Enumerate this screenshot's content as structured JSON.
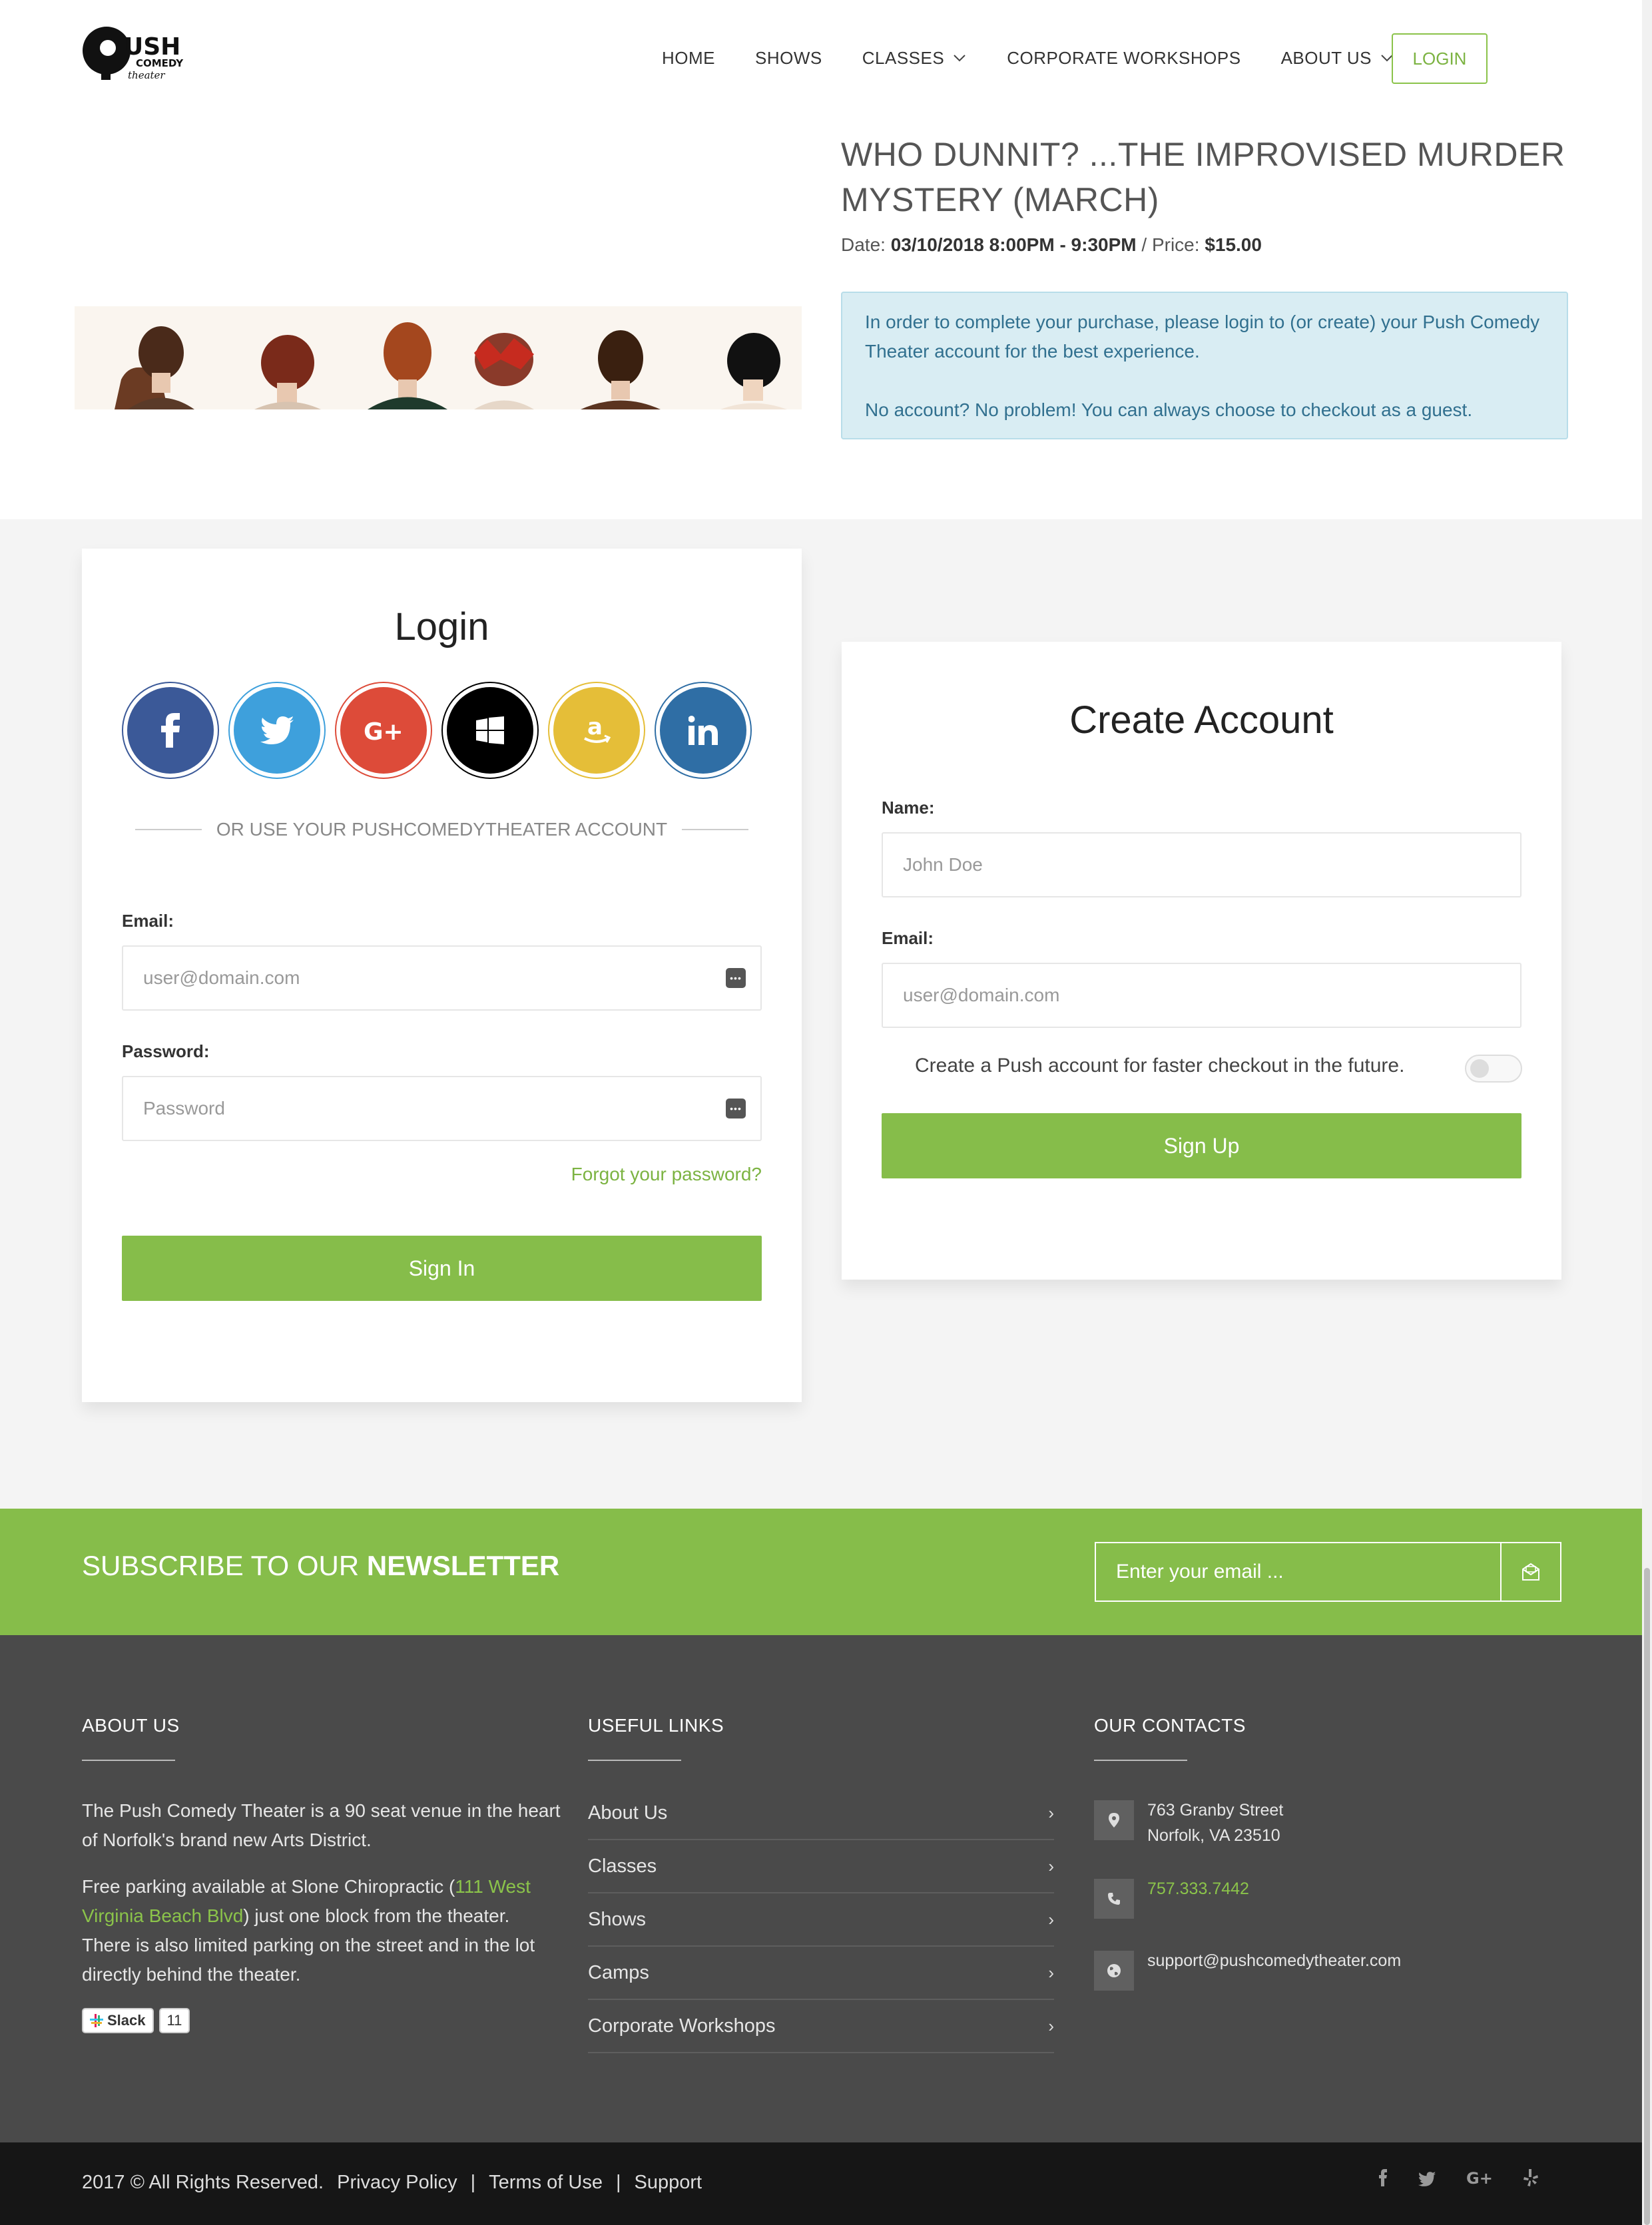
{
  "header": {
    "logo_text": "PUSH COMEDY theater",
    "nav": [
      {
        "label": "HOME",
        "dropdown": false
      },
      {
        "label": "SHOWS",
        "dropdown": false
      },
      {
        "label": "CLASSES",
        "dropdown": true
      },
      {
        "label": "CORPORATE WORKSHOPS",
        "dropdown": false
      },
      {
        "label": "ABOUT US",
        "dropdown": true
      }
    ],
    "login_label": "LOGIN"
  },
  "event": {
    "title": "WHO DUNNIT? ...THE IMPROVISED MURDER MYSTERY (MARCH)",
    "date_label": "Date:",
    "date_value": "03/10/2018 8:00PM - 9:30PM",
    "price_label": "/ Price:",
    "price_value": "$15.00",
    "info_p1": "In order to complete your purchase, please login to (or create) your Push Comedy Theater account for the best experience.",
    "info_p2": "No account? No problem! You can always choose to checkout as a guest."
  },
  "login": {
    "title": "Login",
    "social": [
      "facebook",
      "twitter",
      "google-plus",
      "windows",
      "amazon",
      "linkedin"
    ],
    "divider_text": "OR USE YOUR PUSHCOMEDYTHEATER ACCOUNT",
    "email_label": "Email:",
    "email_placeholder": "user@domain.com",
    "password_label": "Password:",
    "password_placeholder": "Password",
    "forgot": "Forgot your password?",
    "submit": "Sign In"
  },
  "create": {
    "title": "Create Account",
    "name_label": "Name:",
    "name_placeholder": "John Doe",
    "email_label": "Email:",
    "email_placeholder": "user@domain.com",
    "toggle_text": "Create a Push account for faster checkout in the future.",
    "toggle_on": false,
    "submit": "Sign Up"
  },
  "newsletter": {
    "title_light": "SUBSCRIBE TO OUR ",
    "title_bold": "NEWSLETTER",
    "placeholder": "Enter your email ..."
  },
  "footer": {
    "about_title": "ABOUT US",
    "about_p1": "The Push Comedy Theater is a 90 seat venue in the heart of Norfolk's brand new Arts District.",
    "about_p2_pre": "Free parking available at Slone Chiropractic (",
    "about_p2_link": "111 West Virginia Beach Blvd",
    "about_p2_post": ") just one block from the theater. There is also limited parking on the street and in the lot directly behind the theater.",
    "slack_label": "Slack",
    "slack_count": "11",
    "links_title": "USEFUL LINKS",
    "links": [
      "About Us",
      "Classes",
      "Shows",
      "Camps",
      "Corporate Workshops"
    ],
    "contacts_title": "OUR CONTACTS",
    "address_line1": "763 Granby Street",
    "address_line2": "Norfolk, VA 23510",
    "phone": "757.333.7442",
    "email": "support@pushcomedytheater.com"
  },
  "bottom": {
    "copyright": "2017 © All Rights Reserved.",
    "links": [
      "Privacy Policy",
      "Terms of Use",
      "Support"
    ],
    "separator": "|",
    "social": [
      "facebook",
      "twitter",
      "google-plus",
      "yelp"
    ]
  },
  "colors": {
    "accent": "#86bd4a",
    "info_bg": "#d9edf3",
    "footer_bg": "#4a4a4a",
    "bottom_bg": "#161616"
  }
}
